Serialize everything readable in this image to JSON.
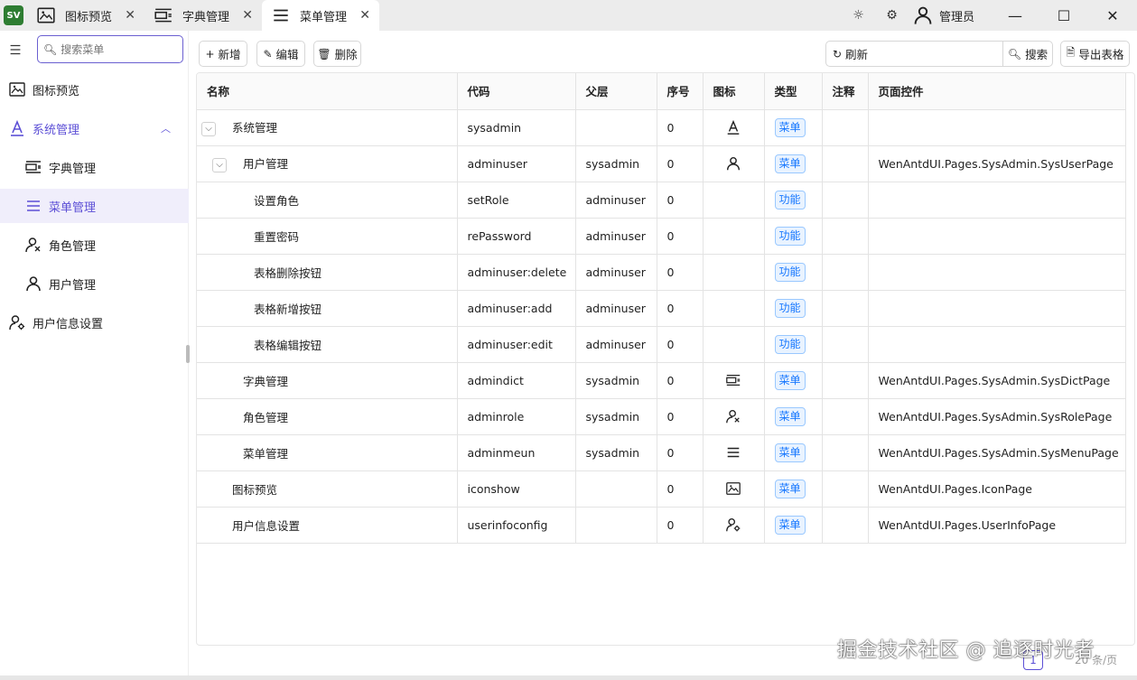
{
  "app": {
    "logo": "SV"
  },
  "tabs": [
    {
      "label": "图标预览",
      "icon": "image-icon",
      "close": "✕"
    },
    {
      "label": "字典管理",
      "icon": "dict-icon",
      "close": "✕"
    },
    {
      "label": "菜单管理",
      "icon": "menu-lines-icon",
      "close": "✕",
      "active": true
    }
  ],
  "titlebar": {
    "user_name": "管理员",
    "theme_icon": "sun-icon",
    "settings_icon": "gear-icon"
  },
  "sidebar": {
    "search_placeholder": "搜索菜单",
    "items": [
      {
        "label": "图标预览",
        "icon": "image-icon"
      },
      {
        "label": "系统管理",
        "icon": "font-a-icon",
        "expanded": true
      },
      {
        "label": "字典管理",
        "icon": "dict-icon"
      },
      {
        "label": "菜单管理",
        "icon": "menu-lines-icon",
        "active": true
      },
      {
        "label": "角色管理",
        "icon": "role-icon"
      },
      {
        "label": "用户管理",
        "icon": "user-icon"
      },
      {
        "label": "用户信息设置",
        "icon": "user-settings-icon"
      }
    ]
  },
  "toolbar": {
    "add_label": "新增",
    "edit_label": "编辑",
    "delete_label": "删除",
    "refresh_label": "刷新",
    "search_label": "搜索",
    "export_label": "导出表格",
    "search_value": ""
  },
  "table": {
    "headers": [
      "名称",
      "代码",
      "父层",
      "序号",
      "图标",
      "类型",
      "注释",
      "页面控件"
    ],
    "rows": [
      {
        "name": "系统管理",
        "code": "sysadmin",
        "parent": "",
        "order": "0",
        "icon": "font-a-icon",
        "type": "菜单",
        "note": "",
        "page": "",
        "level": 0,
        "expander": true
      },
      {
        "name": "用户管理",
        "code": "adminuser",
        "parent": "sysadmin",
        "order": "0",
        "icon": "user-icon",
        "type": "菜单",
        "note": "",
        "page": "WenAntdUI.Pages.SysAdmin.SysUserPage",
        "level": 1,
        "expander": true
      },
      {
        "name": "设置角色",
        "code": "setRole",
        "parent": "adminuser",
        "order": "0",
        "icon": "",
        "type": "功能",
        "note": "",
        "page": "",
        "level": 2
      },
      {
        "name": "重置密码",
        "code": "rePassword",
        "parent": "adminuser",
        "order": "0",
        "icon": "",
        "type": "功能",
        "note": "",
        "page": "",
        "level": 2
      },
      {
        "name": "表格删除按钮",
        "code": "adminuser:delete",
        "parent": "adminuser",
        "order": "0",
        "icon": "",
        "type": "功能",
        "note": "",
        "page": "",
        "level": 2
      },
      {
        "name": "表格新增按钮",
        "code": "adminuser:add",
        "parent": "adminuser",
        "order": "0",
        "icon": "",
        "type": "功能",
        "note": "",
        "page": "",
        "level": 2
      },
      {
        "name": "表格编辑按钮",
        "code": "adminuser:edit",
        "parent": "adminuser",
        "order": "0",
        "icon": "",
        "type": "功能",
        "note": "",
        "page": "",
        "level": 2
      },
      {
        "name": "字典管理",
        "code": "admindict",
        "parent": "sysadmin",
        "order": "0",
        "icon": "dict-icon",
        "type": "菜单",
        "note": "",
        "page": "WenAntdUI.Pages.SysAdmin.SysDictPage",
        "level": 1
      },
      {
        "name": "角色管理",
        "code": "adminrole",
        "parent": "sysadmin",
        "order": "0",
        "icon": "role-icon",
        "type": "菜单",
        "note": "",
        "page": "WenAntdUI.Pages.SysAdmin.SysRolePage",
        "level": 1
      },
      {
        "name": "菜单管理",
        "code": "adminmeun",
        "parent": "sysadmin",
        "order": "0",
        "icon": "menu-lines-icon",
        "type": "菜单",
        "note": "",
        "page": "WenAntdUI.Pages.SysAdmin.SysMenuPage",
        "level": 1
      },
      {
        "name": "图标预览",
        "code": "iconshow",
        "parent": "",
        "order": "0",
        "icon": "image-icon",
        "type": "菜单",
        "note": "",
        "page": "WenAntdUI.Pages.IconPage",
        "level": 0
      },
      {
        "name": "用户信息设置",
        "code": "userinfoconfig",
        "parent": "",
        "order": "0",
        "icon": "user-settings-icon",
        "type": "菜单",
        "note": "",
        "page": "WenAntdUI.Pages.UserInfoPage",
        "level": 0
      }
    ]
  },
  "pager": {
    "current_page": "1",
    "page_size": "20 条/页"
  },
  "watermark": "掘金技术社区 @ 追逐时光者"
}
